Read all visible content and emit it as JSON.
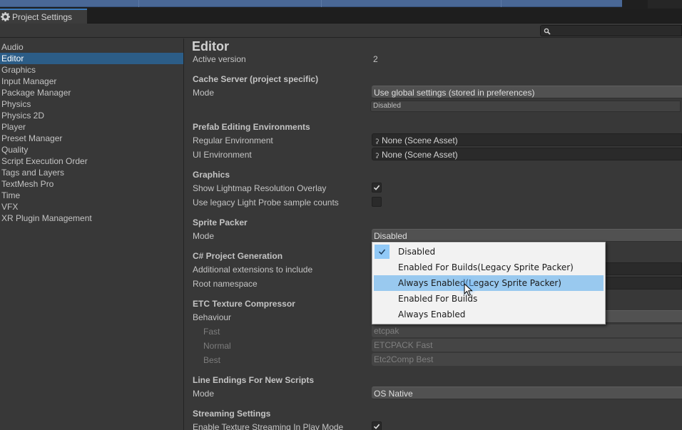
{
  "window": {
    "tab_title": "Project Settings",
    "tab_icon": "gear-icon",
    "search": {
      "placeholder": "",
      "value": "",
      "icon": "search-icon"
    }
  },
  "sidebar": {
    "items": [
      {
        "label": "Audio",
        "selected": false
      },
      {
        "label": "Editor",
        "selected": true
      },
      {
        "label": "Graphics",
        "selected": false
      },
      {
        "label": "Input Manager",
        "selected": false
      },
      {
        "label": "Package Manager",
        "selected": false
      },
      {
        "label": "Physics",
        "selected": false
      },
      {
        "label": "Physics 2D",
        "selected": false
      },
      {
        "label": "Player",
        "selected": false
      },
      {
        "label": "Preset Manager",
        "selected": false
      },
      {
        "label": "Quality",
        "selected": false
      },
      {
        "label": "Script Execution Order",
        "selected": false
      },
      {
        "label": "Tags and Layers",
        "selected": false
      },
      {
        "label": "TextMesh Pro",
        "selected": false
      },
      {
        "label": "Time",
        "selected": false
      },
      {
        "label": "VFX",
        "selected": false
      },
      {
        "label": "XR Plugin Management",
        "selected": false
      }
    ]
  },
  "editor": {
    "title": "Editor",
    "active_version": {
      "label": "Active version",
      "value": "2"
    },
    "cache_server": {
      "header": "Cache Server (project specific)",
      "mode_label": "Mode",
      "mode_value": "Use global settings (stored in preferences)",
      "status_value": "Disabled"
    },
    "prefab": {
      "header": "Prefab Editing Environments",
      "regular_label": "Regular Environment",
      "regular_value": "None (Scene Asset)",
      "ui_label": "UI Environment",
      "ui_value": "None (Scene Asset)"
    },
    "graphics": {
      "header": "Graphics",
      "lightmap_label": "Show Lightmap Resolution Overlay",
      "lightmap_checked": true,
      "legacy_probe_label": "Use legacy Light Probe sample counts",
      "legacy_probe_checked": false
    },
    "sprite_packer": {
      "header": "Sprite Packer",
      "mode_label": "Mode",
      "mode_value": "Disabled"
    },
    "csharp": {
      "header": "C# Project Generation",
      "extensions_label": "Additional extensions to include",
      "namespace_label": "Root namespace"
    },
    "etc": {
      "header": "ETC Texture Compressor",
      "behaviour_label": "Behaviour",
      "fast_label": "Fast",
      "fast_value": "etcpak",
      "normal_label": "Normal",
      "normal_value": "ETCPACK Fast",
      "best_label": "Best",
      "best_value": "Etc2Comp Best"
    },
    "line_endings": {
      "header": "Line Endings For New Scripts",
      "mode_label": "Mode",
      "mode_value": "OS Native"
    },
    "streaming": {
      "header": "Streaming Settings",
      "texture_label": "Enable Texture Streaming In Play Mode",
      "texture_checked": true
    }
  },
  "sprite_packer_menu": {
    "options": [
      {
        "label": "Disabled",
        "checked": true,
        "hovered": false
      },
      {
        "label": "Enabled For Builds(Legacy Sprite Packer)",
        "checked": false,
        "hovered": false
      },
      {
        "label": "Always Enabled(Legacy Sprite Packer)",
        "checked": false,
        "hovered": true
      },
      {
        "label": "Enabled For Builds",
        "checked": false,
        "hovered": false
      },
      {
        "label": "Always Enabled",
        "checked": false,
        "hovered": false
      }
    ]
  },
  "colors": {
    "selection": "#2c5d87",
    "menu_hover": "#99c9ef",
    "tab_accent": "#3a79bb"
  }
}
